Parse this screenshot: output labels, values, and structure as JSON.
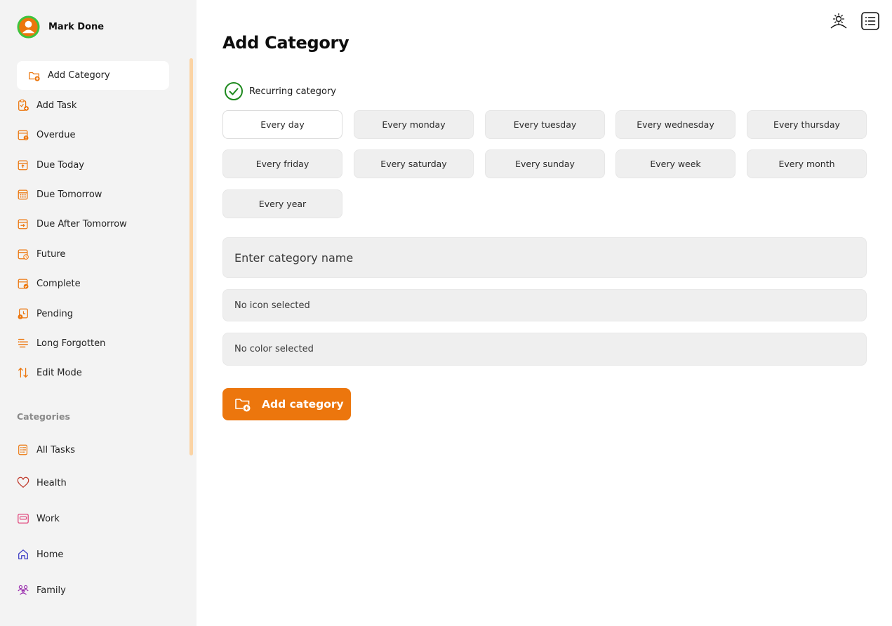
{
  "app": {
    "name": "Mark Done"
  },
  "colors": {
    "accent": "#ec760d",
    "check": "#1f8a1f",
    "scroll": "#fbd3a3"
  },
  "sidebar": {
    "active": {
      "label": "Add Category",
      "icon": "folder-add-icon"
    },
    "items": [
      {
        "label": "Add Task",
        "icon": "clipboard-add-icon"
      },
      {
        "label": "Overdue",
        "icon": "calendar-alert-icon"
      },
      {
        "label": "Due Today",
        "icon": "calendar-today-icon"
      },
      {
        "label": "Due Tomorrow",
        "icon": "calendar-grid-icon"
      },
      {
        "label": "Due After Tomorrow",
        "icon": "calendar-arrow-icon"
      },
      {
        "label": "Future",
        "icon": "calendar-clock-icon"
      },
      {
        "label": "Complete",
        "icon": "calendar-check-icon"
      },
      {
        "label": "Pending",
        "icon": "clock-pending-icon"
      },
      {
        "label": "Long Forgotten",
        "icon": "lines-icon"
      },
      {
        "label": "Edit Mode",
        "icon": "sort-arrows-icon"
      }
    ],
    "categories_label": "Categories",
    "categories": [
      {
        "label": "All Tasks",
        "icon": "task-list-icon",
        "color": "#ec760d"
      },
      {
        "label": "Health",
        "icon": "heart-icon",
        "color": "#c0392b"
      },
      {
        "label": "Work",
        "icon": "briefcase-icon",
        "color": "#e0457b"
      },
      {
        "label": "Home",
        "icon": "home-icon",
        "color": "#3b3bc4"
      },
      {
        "label": "Family",
        "icon": "family-icon",
        "color": "#9b2fae"
      }
    ]
  },
  "header": {
    "theme_icon": "sun-icon",
    "menu_icon": "list-icon"
  },
  "main": {
    "title": "Add Category",
    "recurring_label": "Recurring category",
    "recurrence_options": [
      "Every day",
      "Every monday",
      "Every tuesday",
      "Every wednesday",
      "Every thursday",
      "Every friday",
      "Every saturday",
      "Every sunday",
      "Every week",
      "Every month",
      "Every year"
    ],
    "selected_option": "Every day",
    "name_placeholder": "Enter category name",
    "icon_field": "No icon selected",
    "color_field": "No color selected",
    "submit_label": "Add category"
  }
}
